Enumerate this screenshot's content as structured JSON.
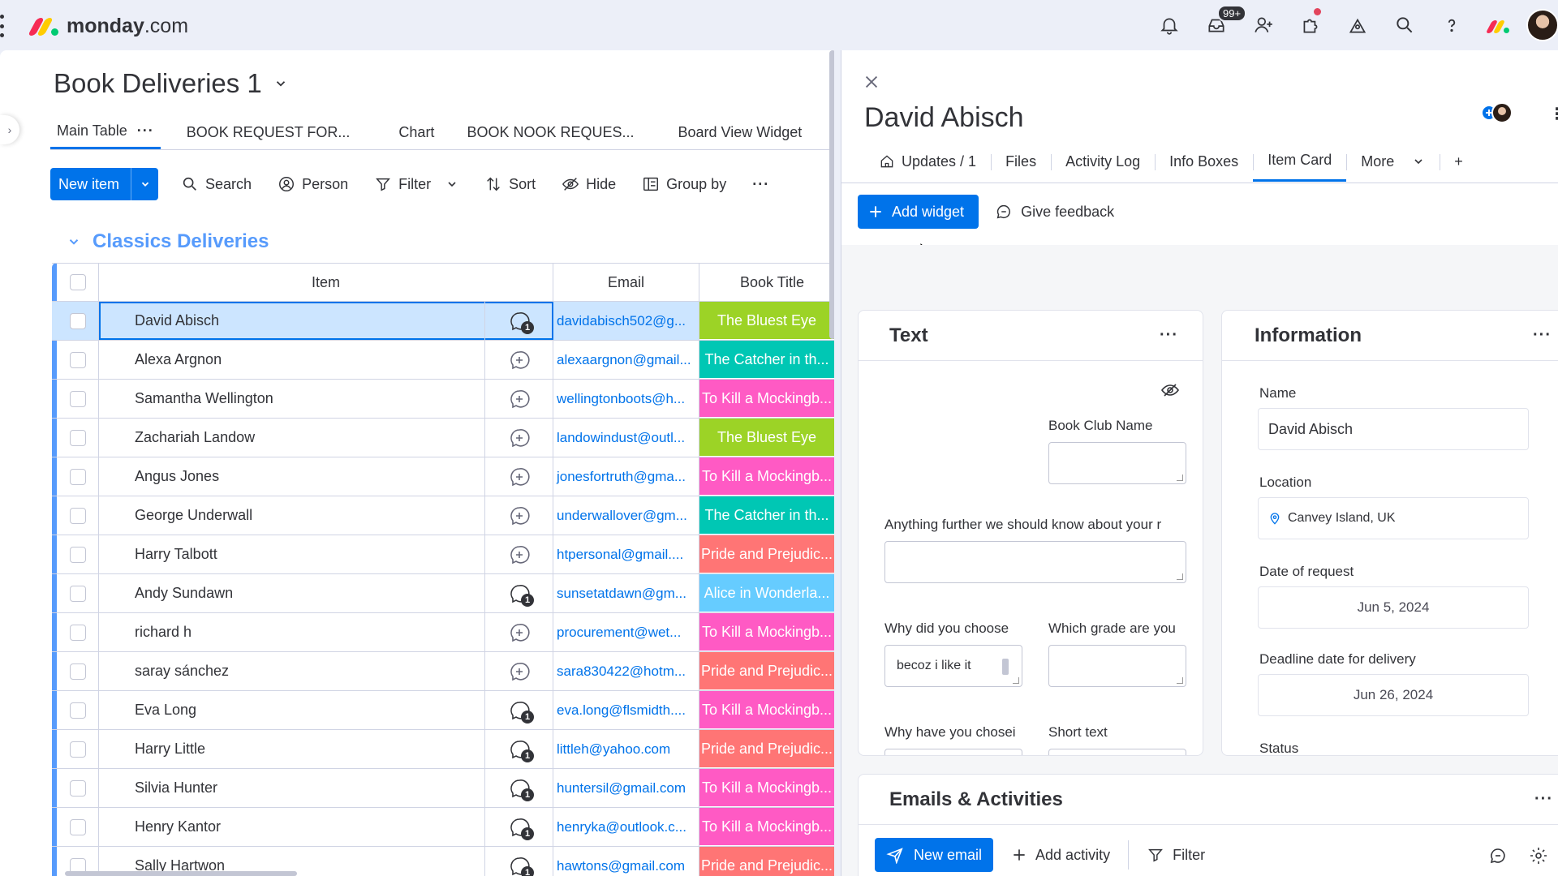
{
  "app": {
    "logo_bold": "monday",
    "logo_rest": ".com",
    "inbox_badge": "99+"
  },
  "board": {
    "title": "Book Deliveries 1",
    "views": [
      "Main Table",
      "BOOK REQUEST FOR...",
      "Chart",
      "BOOK NOOK REQUES...",
      "Board View Widget"
    ],
    "view_more": "···",
    "toolbar": {
      "new_item": "New item",
      "search": "Search",
      "person": "Person",
      "filter": "Filter",
      "sort": "Sort",
      "hide": "Hide",
      "group_by": "Group by",
      "more": "···"
    },
    "group": "Classics Deliveries",
    "columns": {
      "item": "Item",
      "email": "Email",
      "book": "Book Title"
    },
    "rows": [
      {
        "name": "David Abisch",
        "email": "davidabisch502@g...",
        "book": "The Bluest Eye",
        "color": "#9cd326",
        "has_update": true
      },
      {
        "name": "Alexa Argnon",
        "email": "alexaargnon@gmail...",
        "book": "The Catcher in th...",
        "color": "#00c7b4",
        "has_update": false
      },
      {
        "name": "Samantha Wellington",
        "email": "wellingtonboots@h...",
        "book": "To Kill a Mockingb...",
        "color": "#ff5ac4",
        "has_update": false
      },
      {
        "name": "Zachariah Landow",
        "email": "landowindust@outl...",
        "book": "The Bluest Eye",
        "color": "#9cd326",
        "has_update": false
      },
      {
        "name": "Angus Jones",
        "email": "jonesfortruth@gma...",
        "book": "To Kill a Mockingb...",
        "color": "#ff5ac4",
        "has_update": false
      },
      {
        "name": "George Underwall",
        "email": "underwallover@gm...",
        "book": "The Catcher in th...",
        "color": "#00c7b4",
        "has_update": false
      },
      {
        "name": "Harry Talbott",
        "email": "htpersonal@gmail....",
        "book": "Pride and Prejudic...",
        "color": "#ff7575",
        "has_update": false
      },
      {
        "name": "Andy Sundawn",
        "email": "sunsetatdawn@gm...",
        "book": "Alice in Wonderla...",
        "color": "#66ccff",
        "has_update": true
      },
      {
        "name": "richard h",
        "email": "procurement@wet...",
        "book": "To Kill a Mockingb...",
        "color": "#ff5ac4",
        "has_update": false
      },
      {
        "name": "saray sánchez",
        "email": "sara830422@hotm...",
        "book": "Pride and Prejudic...",
        "color": "#ff7575",
        "has_update": false
      },
      {
        "name": "Eva Long",
        "email": "eva.long@flsmidth....",
        "book": "To Kill a Mockingb...",
        "color": "#ff5ac4",
        "has_update": true
      },
      {
        "name": "Harry Little",
        "email": "littleh@yahoo.com",
        "book": "Pride and Prejudic...",
        "color": "#ff7575",
        "has_update": true
      },
      {
        "name": "Silvia Hunter",
        "email": "huntersil@gmail.com",
        "book": "To Kill a Mockingb...",
        "color": "#ff5ac4",
        "has_update": true
      },
      {
        "name": "Henry Kantor",
        "email": "henryka@outlook.c...",
        "book": "To Kill a Mockingb...",
        "color": "#ff5ac4",
        "has_update": true
      },
      {
        "name": "Sally Hartwon",
        "email": "hawtons@gmail.com",
        "book": "Pride and Prejudic...",
        "color": "#ff7575",
        "has_update": true
      }
    ],
    "update_count": "1"
  },
  "panel": {
    "title": "David Abisch",
    "tabs": {
      "updates": "Updates / 1",
      "files": "Files",
      "activity": "Activity Log",
      "info_boxes": "Info Boxes",
      "item_card": "Item Card",
      "more": "More",
      "add": "+"
    },
    "add_widget": "Add widget",
    "give_feedback": "Give feedback",
    "text_card": {
      "title": "Text",
      "more": "···",
      "book_club_label": "Book Club Name",
      "anything_label": "Anything further we should know about your r",
      "why_choose_label": "Why did you choose",
      "why_choose_value": "becoz i like it",
      "grade_label": "Which grade are you",
      "why_chosen_label": "Why have you chosei",
      "short_text_label": "Short text"
    },
    "info_card": {
      "title": "Information",
      "more": "···",
      "name_label": "Name",
      "name_value": "David Abisch",
      "location_label": "Location",
      "location_value": "Canvey Island, UK",
      "date_label": "Date of request",
      "date_value": "Jun 5, 2024",
      "deadline_label": "Deadline date for delivery",
      "deadline_value": "Jun 26, 2024",
      "status_label": "Status"
    },
    "emails_card": {
      "title": "Emails & Activities",
      "more": "···",
      "new_email": "New email",
      "add_activity": "Add activity",
      "filter": "Filter"
    }
  },
  "colors": {
    "accent": "#0073ea",
    "group": "#579bfc"
  }
}
